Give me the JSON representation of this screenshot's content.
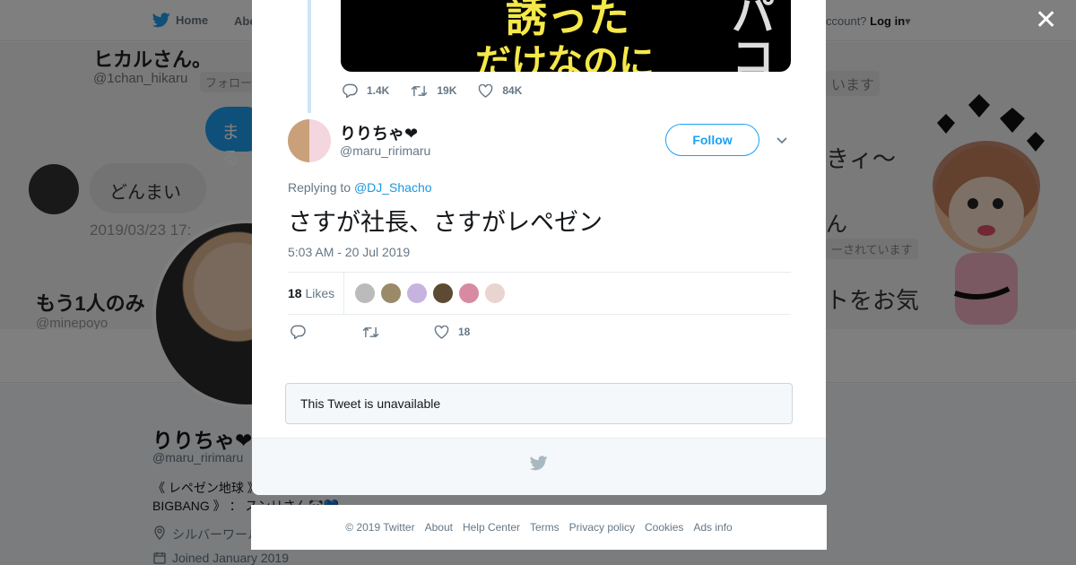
{
  "nav": {
    "home_label": "Home",
    "about_label": "Abo",
    "account_prompt": "ccount?",
    "login_label": "Log in"
  },
  "banner": {
    "name": "ヒカルさん。",
    "handle": "@1chan_hikaru",
    "follow_pill": "フォロー",
    "blue_bubble": "まる",
    "bubble_text": "どんまい",
    "date": "2019/03/23 17:",
    "one_person": "もう1人のみ",
    "other_handle": "@minepoyo",
    "right_pill": "います",
    "right_text_1": "きィ〜",
    "right_text_2": "ん",
    "right_pill_2": "ーされています",
    "right_text_3": "トをお気"
  },
  "profile": {
    "name": "りりちゃ❤",
    "handle": "@maru_ririmaru",
    "bio_line1": "《 レペゼン地球 》",
    "bio_line2": "BIGBANG 》 ： スンリさん🐼💙",
    "location": "シルバーワール",
    "joined": "Joined January 2019"
  },
  "modal": {
    "media_text_1": "誘った",
    "media_text_2": "だけなのに",
    "media_text_3": "パコ",
    "prev_tweet_stats": {
      "replies": "1.4K",
      "retweets": "19K",
      "likes": "84K"
    },
    "tweet": {
      "author_name": "りりちゃ❤",
      "author_handle": "@maru_ririmaru",
      "follow_label": "Follow",
      "replying_prefix": "Replying to",
      "replying_to": "@DJ_Shacho",
      "text": "さすが社長、さすがレペゼン",
      "timestamp": "5:03 AM - 20 Jul 2019",
      "likes_count": "18",
      "likes_label": "Likes",
      "like_action_count": "18"
    },
    "unavailable_text": "This Tweet is unavailable"
  },
  "footer": {
    "links": [
      "© 2019 Twitter",
      "About",
      "Help Center",
      "Terms",
      "Privacy policy",
      "Cookies",
      "Ads info"
    ]
  },
  "colors": {
    "accent": "#1da1f2",
    "link": "#1b95e0",
    "muted": "#657786"
  },
  "icons": [
    "twitter-bird-icon",
    "close-icon",
    "reply-icon",
    "retweet-icon",
    "heart-icon",
    "chevron-down-icon",
    "location-icon",
    "calendar-icon"
  ]
}
